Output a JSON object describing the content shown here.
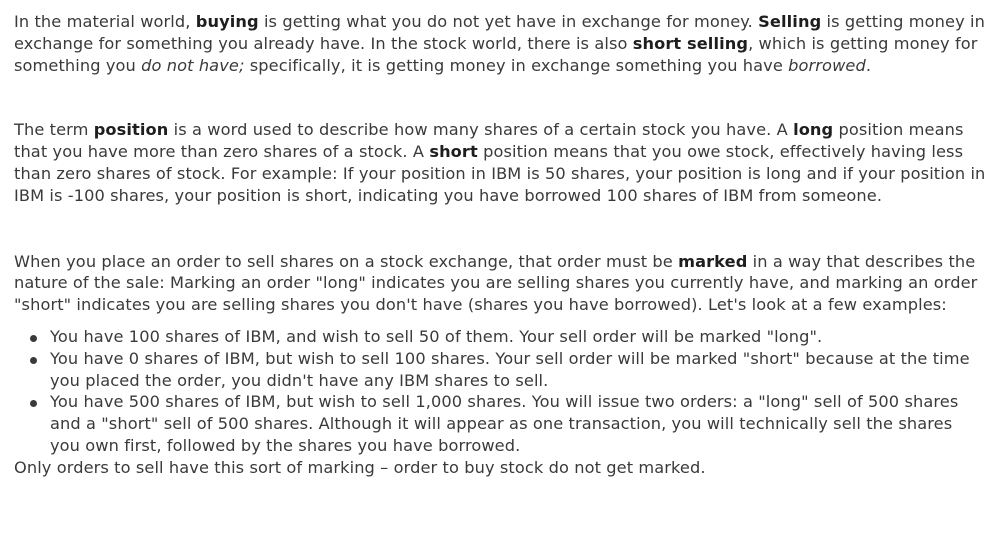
{
  "paragraphs": [
    [
      {
        "t": "In the material world, "
      },
      {
        "t": "buying",
        "b": true
      },
      {
        "t": " is getting what you do not yet have in exchange for money. "
      },
      {
        "t": "Selling",
        "b": true
      },
      {
        "t": " is getting money in exchange for something you already have. In the stock world, there is also "
      },
      {
        "t": "short selling",
        "b": true
      },
      {
        "t": ", which is getting money for something you "
      },
      {
        "t": "do not have;",
        "i": true
      },
      {
        "t": " specifically, it is getting money in exchange something you have "
      },
      {
        "t": "borrowed",
        "i": true
      },
      {
        "t": "."
      }
    ],
    [
      {
        "t": "The term "
      },
      {
        "t": "position",
        "b": true
      },
      {
        "t": " is a word used to describe how many shares of a certain stock you have. A "
      },
      {
        "t": "long",
        "b": true
      },
      {
        "t": " position means that you have more than zero shares of a stock. A "
      },
      {
        "t": "short",
        "b": true
      },
      {
        "t": " position means that you owe stock, effectively having less than zero shares of stock. For example: If your position in IBM is 50 shares, your position is long and if your position in IBM is -100 shares, your position is short, indicating you have borrowed 100 shares of IBM from someone."
      }
    ],
    [
      {
        "t": "When you place an order to sell shares on a stock exchange, that order must be "
      },
      {
        "t": "marked",
        "b": true
      },
      {
        "t": " in a way that describes the nature of the sale: Marking an order \"long\" indicates you are selling shares you currently have, and marking an order \"short\" indicates you are selling shares you don't have (shares you have borrowed). Let's look at a few examples:"
      }
    ]
  ],
  "bullets": [
    "You have 100 shares of IBM, and wish to sell 50 of them. Your sell order will be marked \"long\".",
    "You have 0 shares of IBM, but wish to sell 100 shares. Your sell order will be marked \"short\" because at the time you placed the order, you didn't have any IBM shares to sell.",
    "You have 500 shares of IBM, but wish to sell 1,000 shares. You will issue two orders: a \"long\" sell of 500 shares and a \"short\" sell of 500 shares. Although it will appear as one transaction, you will technically sell the shares you own first, followed by the shares you have borrowed."
  ],
  "closing": "Only orders to sell have this sort of marking – order to buy stock do not get marked."
}
